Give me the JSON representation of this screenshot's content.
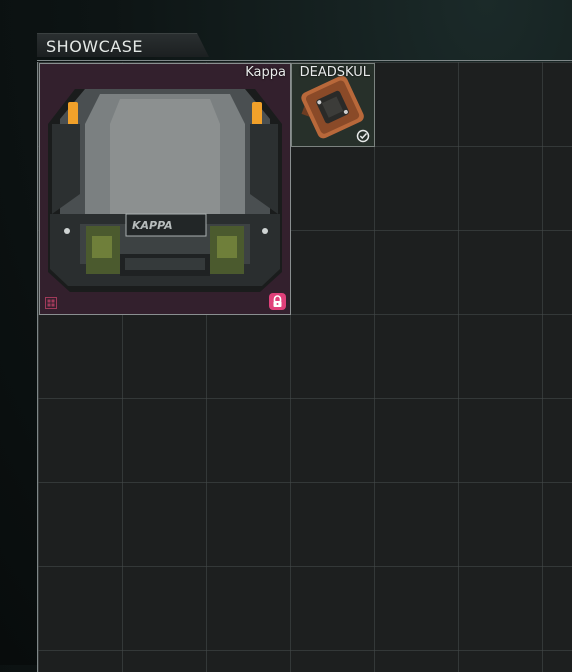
{
  "showcase": {
    "title": "SHOWCASE",
    "items": [
      {
        "name": "Kappa",
        "case_label": "KAPPA",
        "icon": "grid-icon",
        "status_icon": "lock-icon"
      },
      {
        "name": "DEADSKUL",
        "status_icon": "check-icon"
      }
    ]
  },
  "colors": {
    "kappa_background": "#33202d",
    "lock_accent": "#e0407a",
    "case_stripe": "#f2a12a"
  }
}
